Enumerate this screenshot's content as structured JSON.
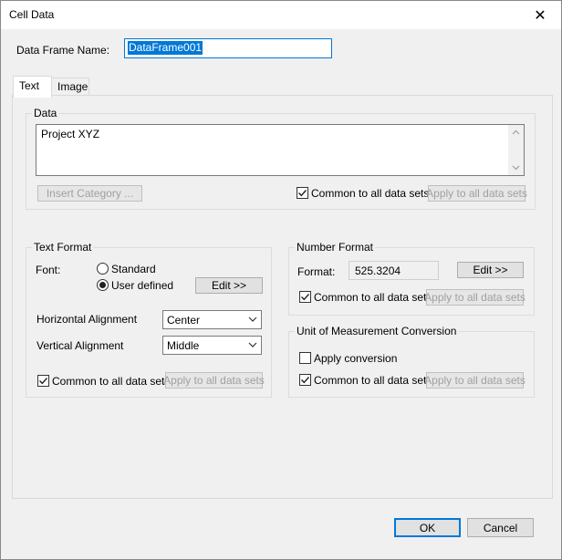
{
  "window": {
    "title": "Cell Data",
    "close_glyph": "✕"
  },
  "data_frame": {
    "label": "Data Frame Name:",
    "value": "DataFrame001"
  },
  "tabs": [
    {
      "label": "Text"
    },
    {
      "label": "Image"
    }
  ],
  "data_group": {
    "title": "Data",
    "text_value": "Project XYZ",
    "insert_category_label": "Insert Category ...",
    "common_label": "Common to all data sets",
    "apply_label": "Apply to all data sets"
  },
  "text_format": {
    "title": "Text Format",
    "font_label": "Font:",
    "standard_label": "Standard",
    "user_defined_label": "User defined",
    "edit_label": "Edit >>",
    "halign_label": "Horizontal Alignment",
    "halign_value": "Center",
    "valign_label": "Vertical Alignment",
    "valign_value": "Middle",
    "common_label": "Common to all data sets",
    "apply_label": "Apply to all data sets"
  },
  "number_format": {
    "title": "Number Format",
    "format_label": "Format:",
    "format_value": "525.3204",
    "edit_label": "Edit >>",
    "common_label": "Common to all data sets",
    "apply_label": "Apply to all data sets"
  },
  "unit_conversion": {
    "title": "Unit of Measurement Conversion",
    "apply_conversion_label": "Apply conversion",
    "common_label": "Common to all data sets",
    "apply_label": "Apply to all data sets"
  },
  "footer": {
    "ok_label": "OK",
    "cancel_label": "Cancel"
  }
}
